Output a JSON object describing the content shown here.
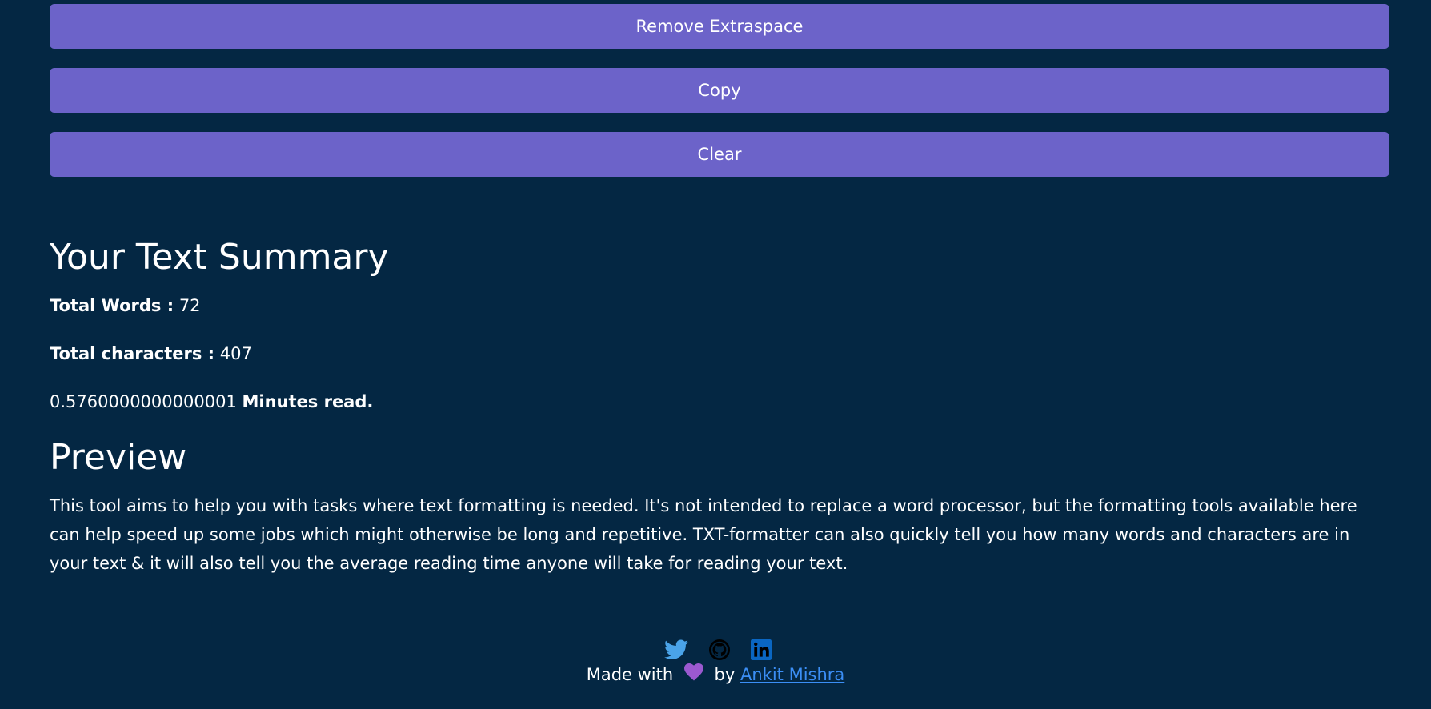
{
  "buttons": {
    "remove_extraspace": "Remove Extraspace",
    "copy": "Copy",
    "clear": "Clear"
  },
  "summary": {
    "heading": "Your Text Summary",
    "words_label": "Total Words :",
    "words_value": "72",
    "chars_label": "Total characters :",
    "chars_value": "407",
    "read_value": "0.5760000000000001",
    "read_label": "Minutes read."
  },
  "preview": {
    "heading": "Preview",
    "text": "This tool aims to help you with tasks where text formatting is needed. It's not intended to replace a word processor, but the formatting tools available here can help speed up some jobs which might otherwise be long and repetitive. TXT-formatter can also quickly tell you how many words and characters are in your text & it will also tell you the average reading time anyone will take for reading your text."
  },
  "footer": {
    "made_with": "Made with",
    "by": "by",
    "author": "Ankit Mishra",
    "icons": [
      "twitter-icon",
      "github-icon",
      "linkedin-icon",
      "heart-icon"
    ]
  },
  "colors": {
    "background": "#042743",
    "button": "#6c63c9",
    "link": "#3b8ef5",
    "twitter": "#4aa3e8",
    "linkedin": "#0a66c2",
    "heart": "#9b59d0"
  }
}
